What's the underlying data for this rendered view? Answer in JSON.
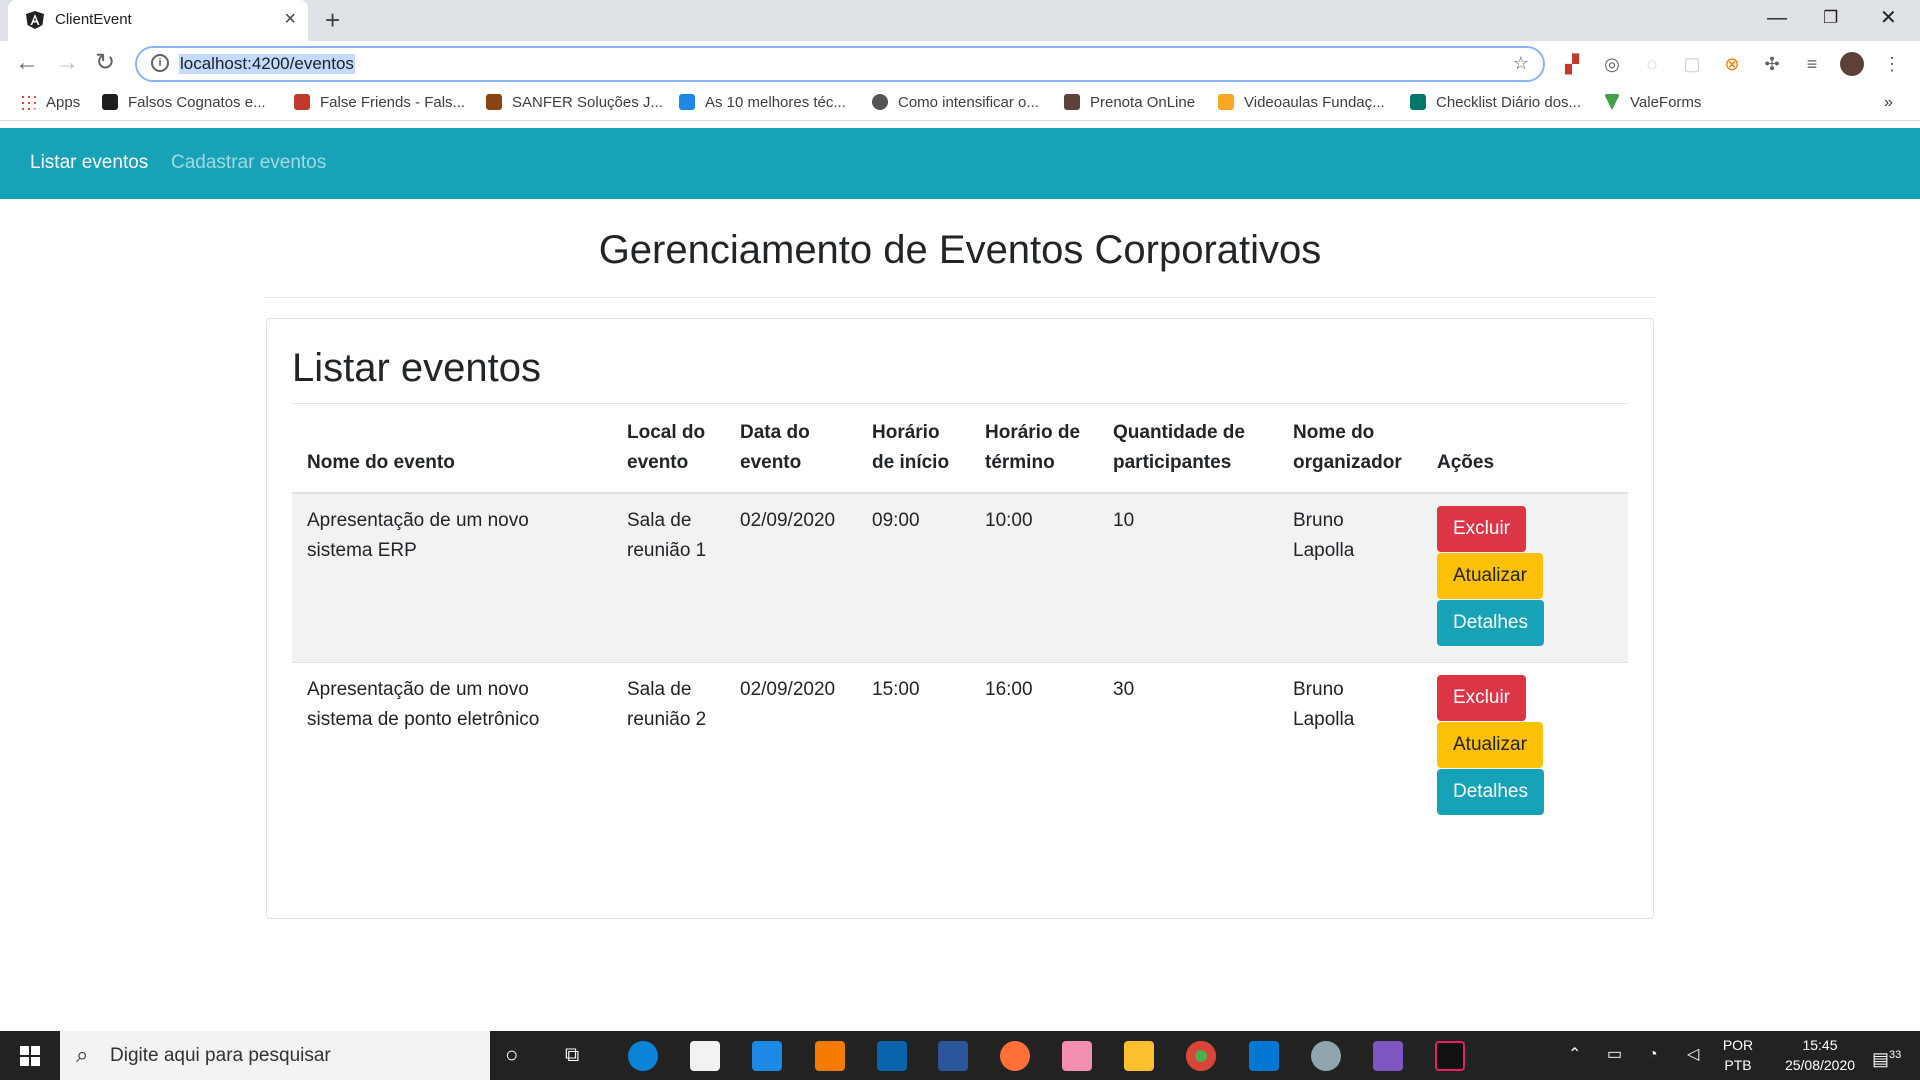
{
  "browser": {
    "tab_title": "ClientEvent",
    "url": "localhost:4200/eventos",
    "bookmarks": [
      {
        "label": "Apps",
        "color": "#ea4335"
      },
      {
        "label": "Falsos Cognatos e...",
        "color": "#1e1e1e"
      },
      {
        "label": "False Friends - Fals...",
        "color": "#c0392b"
      },
      {
        "label": "SANFER Soluções J...",
        "color": "#8b4513"
      },
      {
        "label": "As 10 melhores téc...",
        "color": "#1e88e5"
      },
      {
        "label": "Como intensificar o...",
        "color": "#555555"
      },
      {
        "label": "Prenota OnLine",
        "color": "#5d4037"
      },
      {
        "label": "Videoaulas Fundaç...",
        "color": "#f9a825"
      },
      {
        "label": "Checklist Diário dos...",
        "color": "#00796b"
      },
      {
        "label": "ValeForms",
        "color": "#43a047"
      }
    ]
  },
  "nav": {
    "list_label": "Listar eventos",
    "register_label": "Cadastrar eventos"
  },
  "page": {
    "heading": "Gerenciamento de Eventos Corporativos",
    "card_title": "Listar eventos"
  },
  "table": {
    "headers": [
      "Nome do evento",
      "Local do evento",
      "Data do evento",
      "Horário de início",
      "Horário de término",
      "Quantidade de participantes",
      "Nome do organizador",
      "Ações"
    ],
    "rows": [
      {
        "name": "Apresentação de um novo sistema ERP",
        "local": "Sala de reunião 1",
        "date": "02/09/2020",
        "start": "09:00",
        "end": "10:00",
        "participants": "10",
        "organizer": "Bruno Lapolla"
      },
      {
        "name": "Apresentação de um novo sistema de ponto eletrônico",
        "local": "Sala de reunião 2",
        "date": "02/09/2020",
        "start": "15:00",
        "end": "16:00",
        "participants": "30",
        "organizer": "Bruno Lapolla"
      }
    ],
    "actions": {
      "delete": "Excluir",
      "update": "Atualizar",
      "details": "Detalhes"
    }
  },
  "taskbar": {
    "search_placeholder": "Digite aqui para pesquisar",
    "language": "POR",
    "layout": "PTB",
    "time": "15:45",
    "date": "25/08/2020",
    "notifications": "33"
  },
  "colors": {
    "navbar": "#17a2b8",
    "danger": "#dc3545",
    "warning": "#ffc107",
    "info": "#17a2b8"
  }
}
